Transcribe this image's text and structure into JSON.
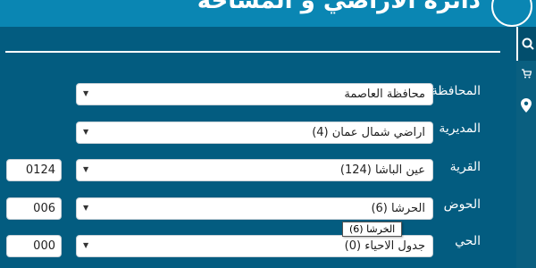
{
  "header": {
    "title": "دائرة الأراضي و المساحة",
    "logo_icon": "dls-seal-icon"
  },
  "rail": {
    "search_icon": "search-icon",
    "cart_icon": "cart-icon",
    "location_icon": "location-pin-icon"
  },
  "form": {
    "governorate": {
      "label": "المحافظة",
      "value": "محافظة العاصمة"
    },
    "directorate": {
      "label": "المديرية",
      "value": "اراضي شمال عمان (4)"
    },
    "village": {
      "label": "القرية",
      "value": "عين الباشا (124)",
      "code": "0124"
    },
    "basin": {
      "label": "الحوض",
      "value": "الحرشا (6)",
      "code": "006"
    },
    "neighborhood": {
      "label": "الحي",
      "value": "جدول الاحياء (0)",
      "code": "000"
    }
  },
  "tooltip": {
    "text": "الخرشا (6)"
  },
  "colors": {
    "header": "#0a86b3",
    "panel": "#035c80",
    "text": "#ffffff"
  }
}
